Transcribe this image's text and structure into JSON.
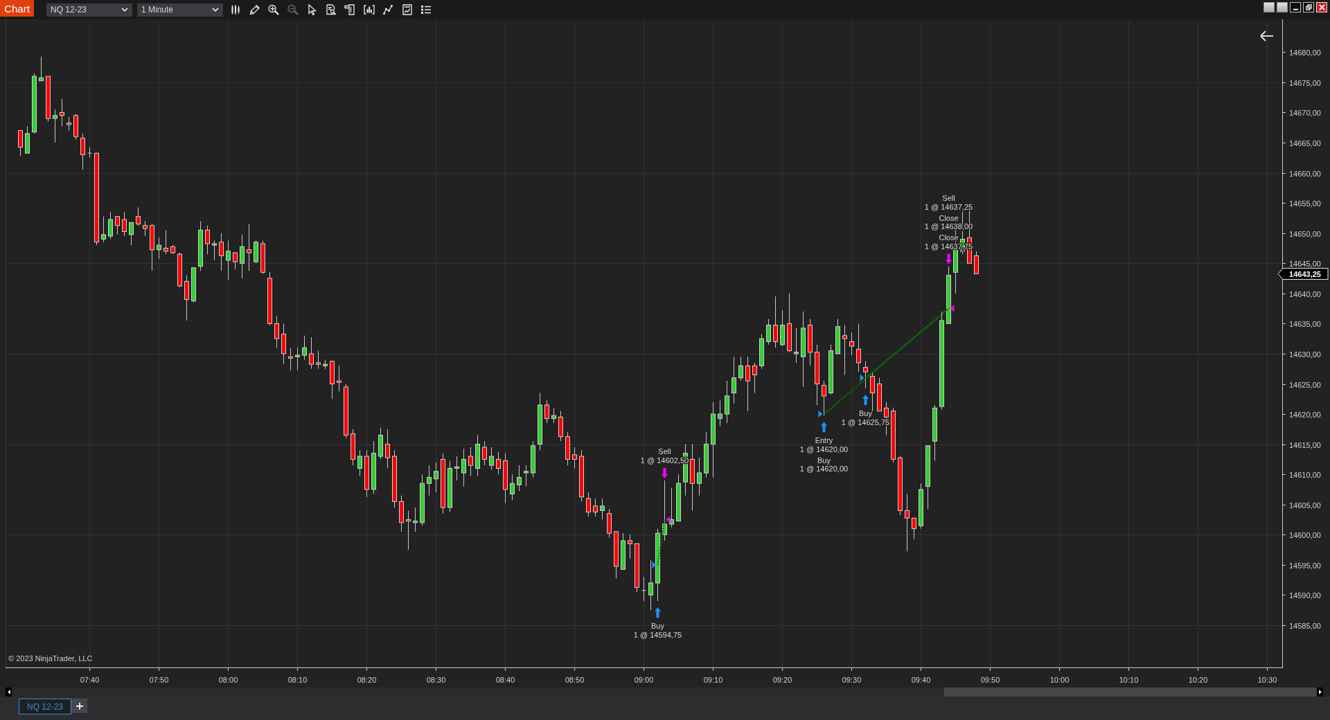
{
  "toolbar": {
    "title": "Chart",
    "instrument": "NQ 12-23",
    "interval": "1 Minute",
    "tools": [
      {
        "disabled": false
      },
      {
        "disabled": false
      },
      {
        "disabled": false
      },
      {
        "disabled": true
      },
      {
        "disabled": false
      },
      {
        "disabled": false
      },
      {
        "disabled": false
      },
      {
        "disabled": false
      },
      {
        "disabled": false
      },
      {
        "disabled": false
      },
      {
        "disabled": false
      }
    ]
  },
  "chart": {
    "copyright": "© 2023 NinjaTrader, LLC",
    "last_price": "14643,25",
    "chart_data": [
      {
        "type": "candlestick",
        "grid": true,
        "xlim": [
          7.4657,
          10.5373
        ],
        "ylim": [
          14578,
          14685.2
        ],
        "xticks": [
          {
            "value": 7.6667,
            "label": "07:40"
          },
          {
            "value": 7.8333,
            "label": "07:50"
          },
          {
            "value": 8,
            "label": "08:00"
          },
          {
            "value": 8.1667,
            "label": "08:10"
          },
          {
            "value": 8.3333,
            "label": "08:20"
          },
          {
            "value": 8.5,
            "label": "08:30"
          },
          {
            "value": 8.6667,
            "label": "08:40"
          },
          {
            "value": 8.8333,
            "label": "08:50"
          },
          {
            "value": 9,
            "label": "09:00"
          },
          {
            "value": 9.1667,
            "label": "09:10"
          },
          {
            "value": 9.3333,
            "label": "09:20"
          },
          {
            "value": 9.5,
            "label": "09:30"
          },
          {
            "value": 9.6667,
            "label": "09:40"
          },
          {
            "value": 9.8333,
            "label": "09:50"
          },
          {
            "value": 10,
            "label": "10:00"
          },
          {
            "value": 10.1667,
            "label": "10:10"
          },
          {
            "value": 10.3333,
            "label": "10:20"
          },
          {
            "value": 10.5,
            "label": "10:30"
          }
        ],
        "yticks": [
          {
            "value": 14585,
            "label": "14585,00"
          },
          {
            "value": 14590,
            "label": "14590,00"
          },
          {
            "value": 14595,
            "label": "14595,00"
          },
          {
            "value": 14600,
            "label": "14600,00"
          },
          {
            "value": 14605,
            "label": "14605,00"
          },
          {
            "value": 14610,
            "label": "14610,00"
          },
          {
            "value": 14615,
            "label": "14615,00"
          },
          {
            "value": 14620,
            "label": "14620,00"
          },
          {
            "value": 14625,
            "label": "14625,00"
          },
          {
            "value": 14630,
            "label": "14630,00"
          },
          {
            "value": 14635,
            "label": "14635,00"
          },
          {
            "value": 14640,
            "label": "14640,00"
          },
          {
            "value": 14645,
            "label": "14645,00"
          },
          {
            "value": 14650,
            "label": "14650,00"
          },
          {
            "value": 14655,
            "label": "14655,00"
          },
          {
            "value": 14660,
            "label": "14660,00"
          },
          {
            "value": 14665,
            "label": "14665,00"
          },
          {
            "value": 14670,
            "label": "14670,00"
          },
          {
            "value": 14675,
            "label": "14675,00"
          },
          {
            "value": 14680,
            "label": "14680,00"
          }
        ],
        "x": [
          7.5,
          7.5167,
          7.5333,
          7.55,
          7.5667,
          7.5833,
          7.6,
          7.6167,
          7.6333,
          7.65,
          7.6667,
          7.6833,
          7.7,
          7.7167,
          7.7333,
          7.75,
          7.7667,
          7.7833,
          7.8,
          7.8167,
          7.8333,
          7.85,
          7.8667,
          7.8833,
          7.9,
          7.9167,
          7.9333,
          7.95,
          7.9667,
          7.9833,
          8,
          8.0167,
          8.0333,
          8.05,
          8.0667,
          8.0833,
          8.1,
          8.1167,
          8.1333,
          8.15,
          8.1667,
          8.1833,
          8.2,
          8.2167,
          8.2333,
          8.25,
          8.2667,
          8.2833,
          8.3,
          8.3167,
          8.3333,
          8.35,
          8.3667,
          8.3833,
          8.4,
          8.4167,
          8.4333,
          8.45,
          8.4667,
          8.4833,
          8.5,
          8.5167,
          8.5333,
          8.55,
          8.5667,
          8.5833,
          8.6,
          8.6167,
          8.6333,
          8.65,
          8.6667,
          8.6833,
          8.7,
          8.7167,
          8.7333,
          8.75,
          8.7667,
          8.7833,
          8.8,
          8.8167,
          8.8333,
          8.85,
          8.8667,
          8.8833,
          8.9,
          8.9167,
          8.9333,
          8.95,
          8.9667,
          8.9833,
          9,
          9.0167,
          9.0333,
          9.05,
          9.0667,
          9.0833,
          9.1,
          9.1167,
          9.1333,
          9.15,
          9.1667,
          9.1833,
          9.2,
          9.2167,
          9.2333,
          9.25,
          9.2667,
          9.2833,
          9.3,
          9.3167,
          9.3333,
          9.35,
          9.3667,
          9.3833,
          9.4,
          9.4167,
          9.4333,
          9.45,
          9.4667,
          9.4833,
          9.5,
          9.5167,
          9.5333,
          9.55,
          9.5667,
          9.5833,
          9.6,
          9.6167,
          9.6333,
          9.65,
          9.6667,
          9.6833,
          9.7,
          9.7167,
          9.7333,
          9.75,
          9.7667,
          9.7833,
          9.8
        ],
        "ohlc": [
          [
            14667,
            14667,
            14662.75,
            14664.25
          ],
          [
            14663.25,
            14667.75,
            14663.25,
            14666.5
          ],
          [
            14666.75,
            14676.5,
            14666.5,
            14676
          ],
          [
            14675.25,
            14679.25,
            14675.25,
            14675.75
          ],
          [
            14676,
            14676,
            14668.5,
            14669
          ],
          [
            14669,
            14670.5,
            14665,
            14669.5
          ],
          [
            14670,
            14672.25,
            14667.75,
            14669.5
          ],
          [
            14668.25,
            14669.25,
            14667,
            14668
          ],
          [
            14669.5,
            14669.75,
            14665.5,
            14666
          ],
          [
            14665.75,
            14666.5,
            14660.5,
            14663
          ],
          [
            14663.25,
            14664.25,
            14662.5,
            14663.25
          ],
          [
            14663.25,
            14663.25,
            14648,
            14648.5
          ],
          [
            14649,
            14652.75,
            14648.5,
            14649.75
          ],
          [
            14649.5,
            14653.5,
            14649,
            14652.25
          ],
          [
            14652.75,
            14652.75,
            14649.75,
            14651.25
          ],
          [
            14652.25,
            14653.5,
            14649.5,
            14650.25
          ],
          [
            14649.75,
            14651.75,
            14648,
            14651.75
          ],
          [
            14652.75,
            14654.25,
            14651.25,
            14651.5
          ],
          [
            14651.25,
            14652,
            14649.5,
            14650.75
          ],
          [
            14651.25,
            14651.5,
            14643.75,
            14647.25
          ],
          [
            14647.25,
            14649.25,
            14645.75,
            14648
          ],
          [
            14647.5,
            14650.5,
            14646.5,
            14647
          ],
          [
            14647.75,
            14648,
            14646.5,
            14646.75
          ],
          [
            14646.5,
            14646.75,
            14641,
            14641.25
          ],
          [
            14642,
            14643,
            14635.5,
            14639
          ],
          [
            14638.75,
            14644.25,
            14638.5,
            14644.25
          ],
          [
            14644.5,
            14652,
            14643.75,
            14650.5
          ],
          [
            14650.5,
            14651.25,
            14646.5,
            14648.25
          ],
          [
            14648,
            14648.75,
            14645.5,
            14648.25
          ],
          [
            14648.5,
            14650,
            14643.75,
            14646.25
          ],
          [
            14645.5,
            14648.75,
            14642.25,
            14647
          ],
          [
            14646.75,
            14646.75,
            14644,
            14645.25
          ],
          [
            14645,
            14649.75,
            14642.5,
            14647.75
          ],
          [
            14647.25,
            14651.5,
            14643.75,
            14646.75
          ],
          [
            14645.25,
            14648.75,
            14645,
            14648.5
          ],
          [
            14648.25,
            14648.75,
            14643.25,
            14643.5
          ],
          [
            14642.5,
            14643.5,
            14634.75,
            14635
          ],
          [
            14635,
            14636.25,
            14631,
            14632.5
          ],
          [
            14633.25,
            14635,
            14628.25,
            14630
          ],
          [
            14629.5,
            14631,
            14627.25,
            14629.25
          ],
          [
            14629.5,
            14631,
            14627.25,
            14629.75
          ],
          [
            14629.75,
            14633,
            14629,
            14631
          ],
          [
            14630,
            14632.75,
            14627.5,
            14628.25
          ],
          [
            14628.5,
            14630.5,
            14627.5,
            14628.25
          ],
          [
            14628,
            14629,
            14627.5,
            14628.25
          ],
          [
            14628.75,
            14628.75,
            14622.5,
            14625
          ],
          [
            14625.5,
            14628,
            14623.75,
            14625.25
          ],
          [
            14624.5,
            14625,
            14616,
            14616.5
          ],
          [
            14616.75,
            14617.5,
            14611.5,
            14612.5
          ],
          [
            14611,
            14614,
            14609.75,
            14613
          ],
          [
            14613,
            14614,
            14606.25,
            14607.5
          ],
          [
            14607.5,
            14615.5,
            14606.75,
            14613.5
          ],
          [
            14613,
            14617.75,
            14612.5,
            14616.5
          ],
          [
            14615,
            14617.5,
            14611,
            14612.75
          ],
          [
            14613,
            14614,
            14604.5,
            14605.5
          ],
          [
            14605.5,
            14606.5,
            14600.5,
            14602
          ],
          [
            14602.5,
            14604,
            14597.5,
            14602.25
          ],
          [
            14602,
            14604.5,
            14600.5,
            14602.25
          ],
          [
            14602,
            14610,
            14601.5,
            14608.5
          ],
          [
            14608.5,
            14611.5,
            14606.5,
            14609.5
          ],
          [
            14609.25,
            14612,
            14607,
            14610.5
          ],
          [
            14612.5,
            14613.5,
            14603.5,
            14604.5
          ],
          [
            14604.5,
            14612.25,
            14603.75,
            14611
          ],
          [
            14611,
            14613,
            14609,
            14611.25
          ],
          [
            14610.25,
            14614.25,
            14608,
            14612.5
          ],
          [
            14613,
            14614.5,
            14609.75,
            14611.5
          ],
          [
            14611,
            14616.5,
            14609.75,
            14615
          ],
          [
            14614.5,
            14615.5,
            14611.5,
            14612.5
          ],
          [
            14611.5,
            14614.5,
            14610.75,
            14613
          ],
          [
            14612.5,
            14613.75,
            14610,
            14611
          ],
          [
            14612.25,
            14613.5,
            14605.25,
            14607.5
          ],
          [
            14606.75,
            14610,
            14605.75,
            14608.5
          ],
          [
            14608.25,
            14611.5,
            14607.25,
            14609.5
          ],
          [
            14610.25,
            14611.5,
            14608,
            14610.5
          ],
          [
            14610.25,
            14615.5,
            14609.5,
            14614.75
          ],
          [
            14615,
            14623.5,
            14614,
            14621.5
          ],
          [
            14621.5,
            14622.25,
            14618.5,
            14619.25
          ],
          [
            14619.25,
            14621,
            14618.5,
            14619.75
          ],
          [
            14619.5,
            14620.5,
            14615.5,
            14616.25
          ],
          [
            14616.25,
            14617,
            14611.5,
            14612.5
          ],
          [
            14613.25,
            14614.5,
            14611,
            14612.5
          ],
          [
            14613,
            14614,
            14605.5,
            14606.25
          ],
          [
            14606,
            14607,
            14603,
            14603.75
          ],
          [
            14604.75,
            14606,
            14603,
            14603.75
          ],
          [
            14604,
            14606,
            14602.5,
            14604.75
          ],
          [
            14603.5,
            14604.25,
            14599.5,
            14600.25
          ],
          [
            14600.5,
            14600.5,
            14592.75,
            14594.75
          ],
          [
            14594.25,
            14600.25,
            14594.25,
            14599
          ],
          [
            14599,
            14600,
            14596,
            14598.5
          ],
          [
            14598.5,
            14598.5,
            14590.5,
            14591.25
          ],
          [
            14590.75,
            14593,
            14589,
            14590.75
          ],
          [
            14590,
            14595.75,
            14587.5,
            14592
          ],
          [
            14592,
            14601,
            14589,
            14600.25
          ],
          [
            14600,
            14609,
            14599,
            14601.75
          ],
          [
            14601.75,
            14607.75,
            14601.25,
            14602.5
          ],
          [
            14602.25,
            14610,
            14602.25,
            14608.5
          ],
          [
            14608.75,
            14615,
            14606.5,
            14613.5
          ],
          [
            14612.5,
            14615,
            14604,
            14608.5
          ],
          [
            14608.5,
            14612.75,
            14606.5,
            14610.25
          ],
          [
            14610.25,
            14617,
            14609.5,
            14615
          ],
          [
            14615,
            14622,
            14609.5,
            14620
          ],
          [
            14619.25,
            14622.25,
            14618,
            14620
          ],
          [
            14620,
            14625.5,
            14618.5,
            14623
          ],
          [
            14623.5,
            14629.5,
            14621.75,
            14626
          ],
          [
            14626,
            14629.5,
            14625.5,
            14628
          ],
          [
            14628,
            14629.5,
            14620.5,
            14625.5
          ],
          [
            14628,
            14628.5,
            14623.5,
            14626.5
          ],
          [
            14628,
            14633.25,
            14627.5,
            14632.5
          ],
          [
            14632,
            14635.75,
            14631.5,
            14634.75
          ],
          [
            14634.75,
            14639.5,
            14631,
            14632
          ],
          [
            14631.5,
            14637.25,
            14631.25,
            14634.75
          ],
          [
            14635,
            14640,
            14630.25,
            14630.5
          ],
          [
            14630,
            14634.25,
            14628.5,
            14630.25
          ],
          [
            14629.5,
            14637,
            14624.5,
            14634.25
          ],
          [
            14634.75,
            14635.75,
            14628,
            14630.25
          ],
          [
            14630.25,
            14631.5,
            14621.5,
            14625
          ],
          [
            14624.75,
            14625.5,
            14619.75,
            14623
          ],
          [
            14623.5,
            14631.5,
            14623.25,
            14630.5
          ],
          [
            14630,
            14635.75,
            14630,
            14634.5
          ],
          [
            14633,
            14634.75,
            14626.5,
            14632.5
          ],
          [
            14632,
            14633.5,
            14629.75,
            14631.25
          ],
          [
            14630.75,
            14635,
            14627,
            14628.5
          ],
          [
            14627.75,
            14628.75,
            14624.25,
            14627
          ],
          [
            14626.25,
            14627,
            14620.25,
            14623.5
          ],
          [
            14625,
            14626,
            14620.5,
            14620.5
          ],
          [
            14621,
            14622,
            14616.5,
            14619.5
          ],
          [
            14620.5,
            14621,
            14612,
            14612.5
          ],
          [
            14612.75,
            14613,
            14603.25,
            14604
          ],
          [
            14604,
            14606.75,
            14597.25,
            14602.75
          ],
          [
            14602.75,
            14602.75,
            14599.25,
            14601
          ],
          [
            14601.5,
            14608.5,
            14601,
            14607.5
          ],
          [
            14608,
            14614.75,
            14604.25,
            14614.75
          ],
          [
            14615.5,
            14621.5,
            14612.25,
            14621
          ],
          [
            14621.25,
            14637,
            14620.75,
            14635.5
          ],
          [
            14635,
            14644.5,
            14635,
            14643
          ],
          [
            14643.5,
            14650.75,
            14640,
            14648.25
          ],
          [
            14647,
            14654,
            14646.5,
            14649
          ],
          [
            14649.25,
            14654,
            14645,
            14645
          ],
          [
            14646.25,
            14647,
            14643.25,
            14643.25
          ]
        ],
        "series": [
          {
            "type": "line",
            "line_style": "dotted",
            "marker": "triangle",
            "color": "#008000",
            "colors": [
              "#1e90ff",
              "#ff00ff"
            ],
            "x": [
              9.0333,
              9.05
            ],
            "values": [
              14595,
              14602.5
            ]
          },
          {
            "type": "line",
            "line_style": "dotted",
            "marker": "triangle",
            "color": "#008000",
            "colors": [
              "#1e90ff",
              "#ff00ff"
            ],
            "x": [
              9.4333,
              9.7333
            ],
            "values": [
              14620,
              14637.5
            ]
          },
          {
            "type": "line",
            "line_style": "dotted",
            "marker": "triangle",
            "color": "#008000",
            "colors": [
              "#1e90ff",
              "#ff00ff"
            ],
            "x": [
              9.5333,
              9.7333
            ],
            "values": [
              14626,
              14637.5
            ]
          }
        ],
        "annotations": [
          "Buy\n1 @ 14594,75",
          "Sell\n1 @ 14602,50",
          "Entry\n1 @ 14620,00\nBuy\n1 @ 14620,00",
          "Buy\n1 @ 14625,75",
          "Sell\n1 @ 14637,25\nClose\n1 @ 14638,00\nClose\n1 @ 14637,75"
        ]
      }
    ]
  },
  "tabs": [
    {
      "label": "NQ 12-23",
      "selected": true
    }
  ]
}
